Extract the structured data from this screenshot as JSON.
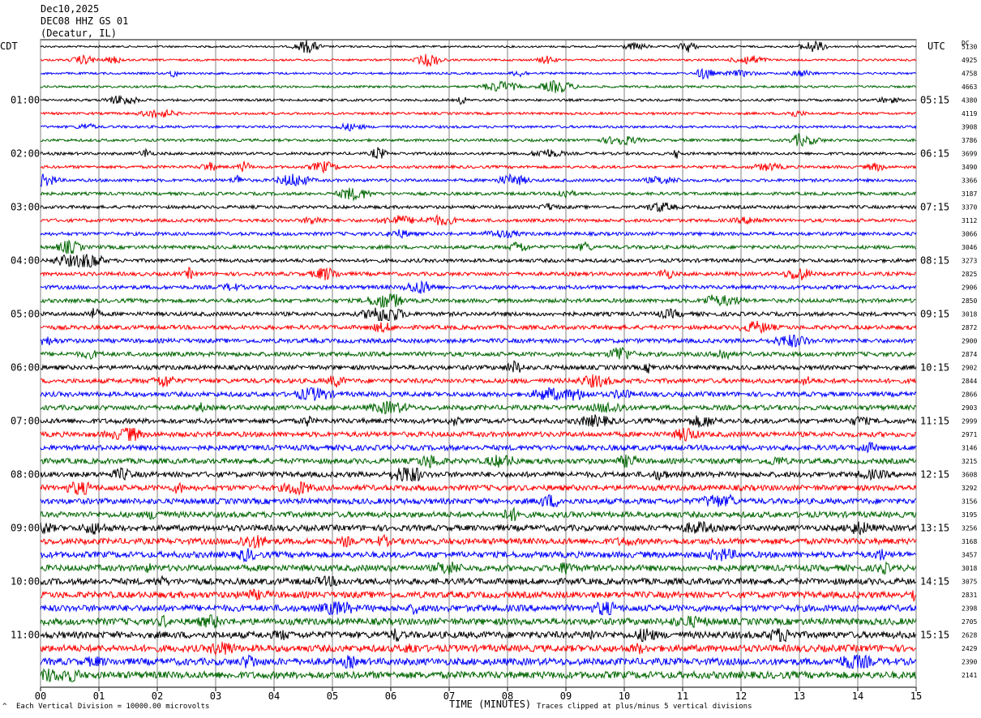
{
  "header": {
    "date": "Dec10,2025",
    "station": "DEC08 HHZ GS 01",
    "location": "(Decatur, IL)"
  },
  "left_zone": "CDT",
  "right_zone": "UTC",
  "dc_label": "DC",
  "footer": {
    "scale_note": "Each Vertical Division = 10000.00 microvolts",
    "clip_note": "Traces clipped at plus/minus 5 vertical divisions",
    "corner_mark": "^"
  },
  "colors": {
    "black": "#000000",
    "red": "#ff0000",
    "blue": "#0000ff",
    "green": "#006600",
    "grid": "#808080"
  },
  "chart_data": {
    "type": "line",
    "title": "",
    "xlabel": "TIME (MINUTES)",
    "xlim": [
      0,
      15
    ],
    "x_ticks": [
      "00",
      "01",
      "02",
      "03",
      "04",
      "05",
      "06",
      "07",
      "08",
      "09",
      "10",
      "11",
      "12",
      "13",
      "14",
      "15"
    ],
    "trace_color_cycle": [
      "black",
      "red",
      "blue",
      "green"
    ],
    "trace_count": 48,
    "left_time_labels": [
      "01:00",
      "02:00",
      "03:00",
      "04:00",
      "05:00",
      "06:00",
      "07:00",
      "08:00",
      "09:00",
      "10:00",
      "11:00"
    ],
    "right_time_labels": [
      "05:15",
      "06:15",
      "07:15",
      "08:15",
      "09:15",
      "10:15",
      "11:15",
      "12:15",
      "13:15",
      "14:15",
      "15:15"
    ],
    "dc_offsets": [
      "5130",
      "4925",
      "4758",
      "4663",
      "4380",
      "4119",
      "3908",
      "3786",
      "3699",
      "3490",
      "3366",
      "3187",
      "3370",
      "3112",
      "3066",
      "3046",
      "3273",
      "2825",
      "2906",
      "2850",
      "3018",
      "2872",
      "2900",
      "2874",
      "2902",
      "2844",
      "2866",
      "2903",
      "2999",
      "2971",
      "3146",
      "3215",
      "3608",
      "3292",
      "3156",
      "3195",
      "3256",
      "3168",
      "3457",
      "3018",
      "3075",
      "2831",
      "2398",
      "2705",
      "2628",
      "2429",
      "2390",
      "2141"
    ]
  }
}
